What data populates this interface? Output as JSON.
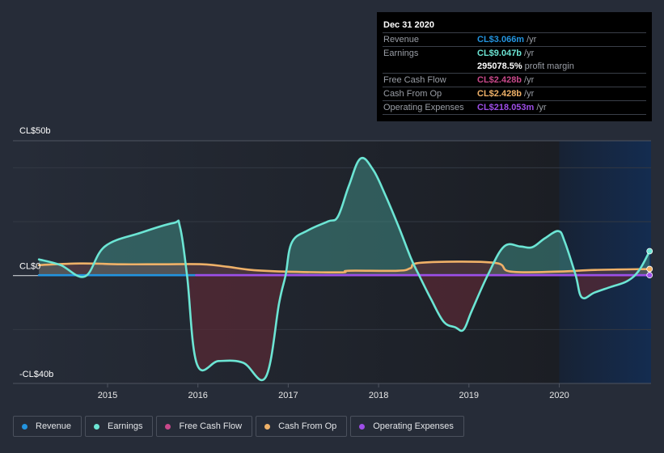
{
  "tooltip": {
    "date": "Dec 31 2020",
    "rows": [
      {
        "label": "Revenue",
        "value": "CL$3.066m",
        "unit": "/yr",
        "color": "#2394df"
      },
      {
        "label": "Earnings",
        "value": "CL$9.047b",
        "unit": "/yr",
        "color": "#6ce5d4"
      },
      {
        "label": "",
        "value": "295078.5%",
        "unit": "profit margin",
        "color": "#ffffff"
      },
      {
        "label": "Free Cash Flow",
        "value": "CL$2.428b",
        "unit": "/yr",
        "color": "#c8488a"
      },
      {
        "label": "Cash From Op",
        "value": "CL$2.428b",
        "unit": "/yr",
        "color": "#efb168"
      },
      {
        "label": "Operating Expenses",
        "value": "CL$218.053m",
        "unit": "/yr",
        "color": "#9e4ee8"
      }
    ]
  },
  "legend": [
    {
      "label": "Revenue",
      "color": "#2394df"
    },
    {
      "label": "Earnings",
      "color": "#6ce5d4"
    },
    {
      "label": "Free Cash Flow",
      "color": "#c8488a"
    },
    {
      "label": "Cash From Op",
      "color": "#efb168"
    },
    {
      "label": "Operating Expenses",
      "color": "#9e4ee8"
    }
  ],
  "chart_data": {
    "type": "area",
    "title": "",
    "xlabel": "",
    "ylabel": "",
    "units": "CL$ billions",
    "ylim": [
      -40,
      50
    ],
    "xlim": [
      2014.24,
      2021.0
    ],
    "y_tick_labels": [
      {
        "value": 50,
        "label": "CL$50b"
      },
      {
        "value": 0,
        "label": "CL$0"
      },
      {
        "value": -40,
        "label": "-CL$40b"
      }
    ],
    "y_gridlines": [
      50,
      40,
      20,
      0,
      -20,
      -40
    ],
    "x_ticks": [
      2015,
      2016,
      2017,
      2018,
      2019,
      2020
    ],
    "x_tick_labels": [
      "2015",
      "2016",
      "2017",
      "2018",
      "2019",
      "2020"
    ],
    "highlight_range": [
      2020.0,
      2021.0
    ],
    "grid": true,
    "legend_position": "bottom-left",
    "series": [
      {
        "name": "Revenue",
        "color": "#2394df",
        "x": [
          2014.24,
          2016.0,
          2021.0
        ],
        "values": [
          0.0,
          0.0,
          0.003
        ]
      },
      {
        "name": "Earnings",
        "color": "#6ce5d4",
        "x": [
          2014.24,
          2014.48,
          2014.75,
          2014.97,
          2015.37,
          2015.73,
          2015.8,
          2015.88,
          2015.99,
          2016.23,
          2016.5,
          2016.75,
          2016.9,
          2016.97,
          2017.04,
          2017.22,
          2017.44,
          2017.55,
          2017.67,
          2017.8,
          2017.94,
          2018.07,
          2018.22,
          2018.36,
          2018.45,
          2018.58,
          2018.72,
          2018.85,
          2018.94,
          2019.03,
          2019.21,
          2019.39,
          2019.57,
          2019.7,
          2019.84,
          2019.99,
          2020.06,
          2020.18,
          2020.25,
          2020.39,
          2020.57,
          2020.75,
          2020.88,
          2021.0
        ],
        "values": [
          6.0,
          3.9,
          -0.3,
          10.8,
          15.9,
          19.5,
          18.3,
          0.0,
          -32.9,
          -31.7,
          -32.3,
          -37.7,
          -10.0,
          0.0,
          12.3,
          16.8,
          20.1,
          21.9,
          33.2,
          43.4,
          39.2,
          30.2,
          18.3,
          6.3,
          0.0,
          -8.7,
          -17.1,
          -19.2,
          -20.1,
          -13.2,
          0.3,
          10.8,
          10.8,
          10.5,
          13.8,
          16.5,
          12.6,
          0.3,
          -8.1,
          -6.3,
          -4.2,
          -2.1,
          1.8,
          9.05
        ]
      },
      {
        "name": "Free Cash Flow",
        "color": "#c8488a",
        "x": [
          2014.24,
          2021.0
        ],
        "values": [
          2.4,
          2.43
        ]
      },
      {
        "name": "Cash From Op",
        "color": "#efb168",
        "x": [
          2014.24,
          2014.7,
          2015.15,
          2015.6,
          2016.05,
          2016.32,
          2016.59,
          2016.95,
          2017.58,
          2017.67,
          2018.21,
          2018.35,
          2018.48,
          2019.27,
          2019.46,
          2020.0,
          2020.4,
          2021.0
        ],
        "values": [
          3.9,
          4.5,
          4.2,
          4.2,
          4.2,
          3.3,
          2.1,
          1.5,
          1.2,
          1.8,
          1.8,
          2.7,
          4.8,
          4.8,
          1.5,
          1.5,
          2.1,
          2.43
        ]
      },
      {
        "name": "Operating Expenses",
        "color": "#9e4ee8",
        "x": [
          2015.98,
          2021.0
        ],
        "values": [
          0.2,
          0.218
        ]
      }
    ]
  }
}
